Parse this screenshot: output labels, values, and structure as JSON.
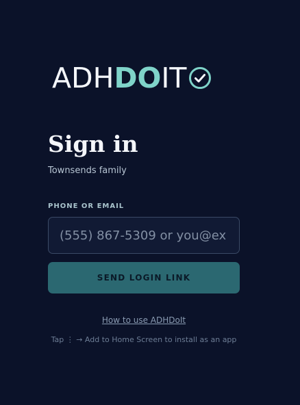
{
  "brand": {
    "logo_part1": "ADH",
    "logo_part2": "DO",
    "logo_part3": "IT",
    "colors": {
      "background": "#0b1229",
      "accent": "#7fd3c9",
      "button": "#2b6871"
    }
  },
  "signin": {
    "title": "Sign in",
    "subtitle": "Townsends family"
  },
  "form": {
    "field_label": "PHONE OR EMAIL",
    "field_value": "",
    "field_placeholder": "(555) 867-5309 or you@ex",
    "submit_label": "SEND LOGIN LINK"
  },
  "footer": {
    "help_link": "How to use ADHDoIt",
    "install_hint": "Tap ⋮ → Add to Home Screen to install as an app"
  }
}
